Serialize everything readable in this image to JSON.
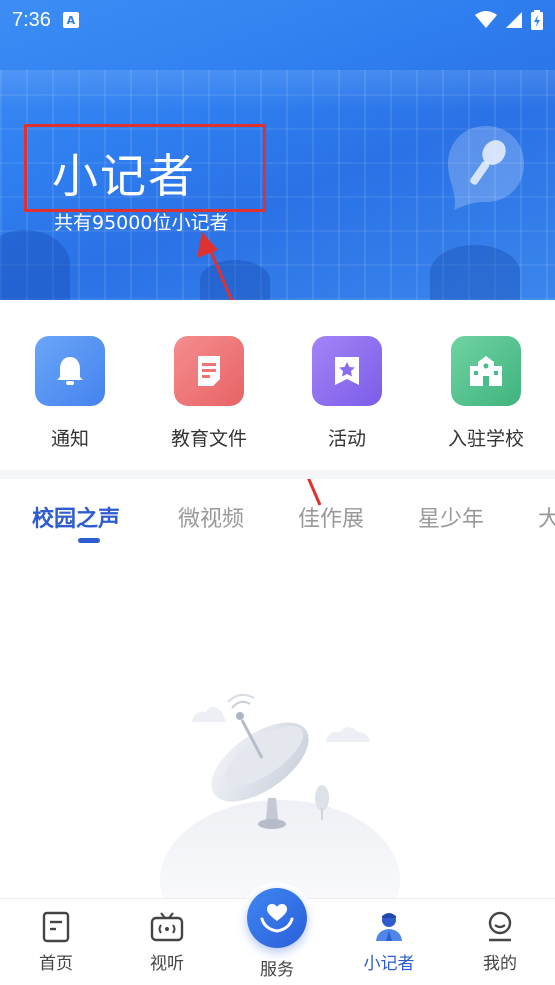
{
  "status_bar": {
    "time": "7:36",
    "badge": "A"
  },
  "hero": {
    "title": "小记者",
    "subtitle": "共有95000位小记者"
  },
  "quick_entries": [
    {
      "label": "通知",
      "icon": "bell-icon",
      "color": "#4f8ff3"
    },
    {
      "label": "教育文件",
      "icon": "document-icon",
      "color": "#ef7274"
    },
    {
      "label": "活动",
      "icon": "bookmark-star-icon",
      "color": "#8a6cf0"
    },
    {
      "label": "入驻学校",
      "icon": "school-icon",
      "color": "#48bd89"
    }
  ],
  "tabs": [
    {
      "label": "校园之声",
      "active": true
    },
    {
      "label": "微视频",
      "active": false
    },
    {
      "label": "佳作展",
      "active": false
    },
    {
      "label": "星少年",
      "active": false
    },
    {
      "label": "大",
      "active": false
    }
  ],
  "bottom_nav": [
    {
      "label": "首页",
      "icon": "home-doc-icon",
      "active": false
    },
    {
      "label": "视听",
      "icon": "tv-icon",
      "active": false
    },
    {
      "label": "服务",
      "icon": "heart-hands-icon",
      "active": false
    },
    {
      "label": "小记者",
      "icon": "reporter-icon",
      "active": true
    },
    {
      "label": "我的",
      "icon": "profile-icon",
      "active": false
    }
  ],
  "colors": {
    "accent": "#2e5ccf",
    "hero": "#2f7ff0",
    "annotation_red": "#e03131"
  }
}
